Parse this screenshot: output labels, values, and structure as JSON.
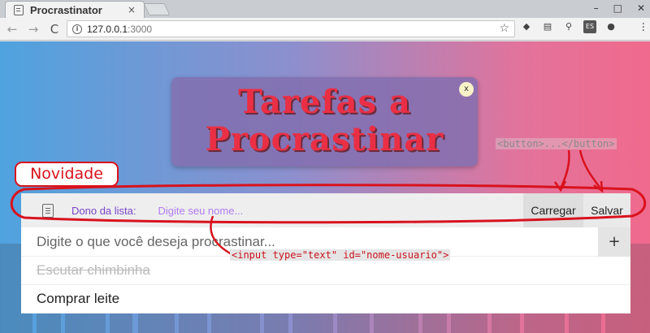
{
  "browser": {
    "tab_title": "Procrastinator",
    "tab_close": "×",
    "url_host": "127.0.0.1",
    "url_port": ":3000",
    "nav": {
      "back": "←",
      "forward": "→",
      "reload": "C"
    }
  },
  "page": {
    "title_line1": "Tarefas a",
    "title_line2": "Procrastinar",
    "close_label": "x",
    "owner_label": "Dono da lista:",
    "owner_placeholder": "Digite seu nome...",
    "load_button": "Carregar",
    "save_button": "Salvar",
    "new_task_placeholder": "Digite o que você deseja procrastinar...",
    "add_button": "+",
    "tasks": [
      {
        "text": "Escutar chimbinha",
        "done": true
      },
      {
        "text": "Comprar leite",
        "done": false
      }
    ]
  },
  "annotations": {
    "badge": "Novidade",
    "button_code": "<button>...</button>",
    "input_code": "<input type=\"text\" id=\"nome-usuario\">"
  },
  "colors": {
    "gradient_left": "#4fa3df",
    "gradient_right": "#f06a8d",
    "title_text": "#ea2f45",
    "annotation_red": "#d9121d",
    "owner_label": "#7a45c8"
  }
}
